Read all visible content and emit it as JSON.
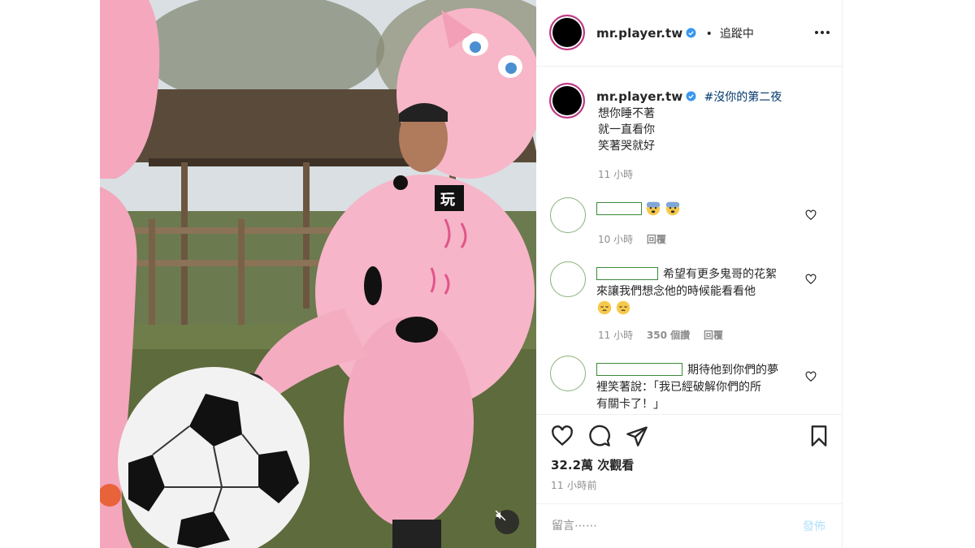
{
  "post": {
    "username": "mr.player.tw",
    "separator": "•",
    "follow_status": "追蹤中",
    "more_icon": "more-horizontal-icon",
    "verified_icon": "verified-badge-icon"
  },
  "caption": {
    "username": "mr.player.tw",
    "hashtag": "#沒你的第二夜",
    "lines": [
      "想你睡不著",
      "就一直看你",
      "笑著哭就好"
    ],
    "time": "11 小時"
  },
  "comments": [
    {
      "text": "",
      "emoji": [
        "anxious-face-icon",
        "anxious-face-icon"
      ],
      "time": "10 小時",
      "reply_label": "回覆"
    },
    {
      "line1": "希望有更多鬼哥的花絮",
      "line2": "來讓我們想念他的時候能看看他",
      "emoji": [
        "pensive-face-icon",
        "pensive-face-icon"
      ],
      "time": "11 小時",
      "likes": "350 個讚",
      "reply_label": "回覆"
    },
    {
      "line1": "期待他到你們的夢",
      "line2": "裡笑著說：「我已經破解你們的所",
      "line3": "有關卡了！」"
    }
  ],
  "stats": {
    "views": "32.2萬 次觀看",
    "posted_ago": "11 小時前"
  },
  "composer": {
    "placeholder": "留言⋯⋯",
    "post_label": "發佈"
  },
  "colors": {
    "link": "#00376b",
    "muted": "#8e8e8e",
    "verified": "#3897f0",
    "post_disabled": "#b2dffc",
    "avatar_ring": "#c13584"
  }
}
